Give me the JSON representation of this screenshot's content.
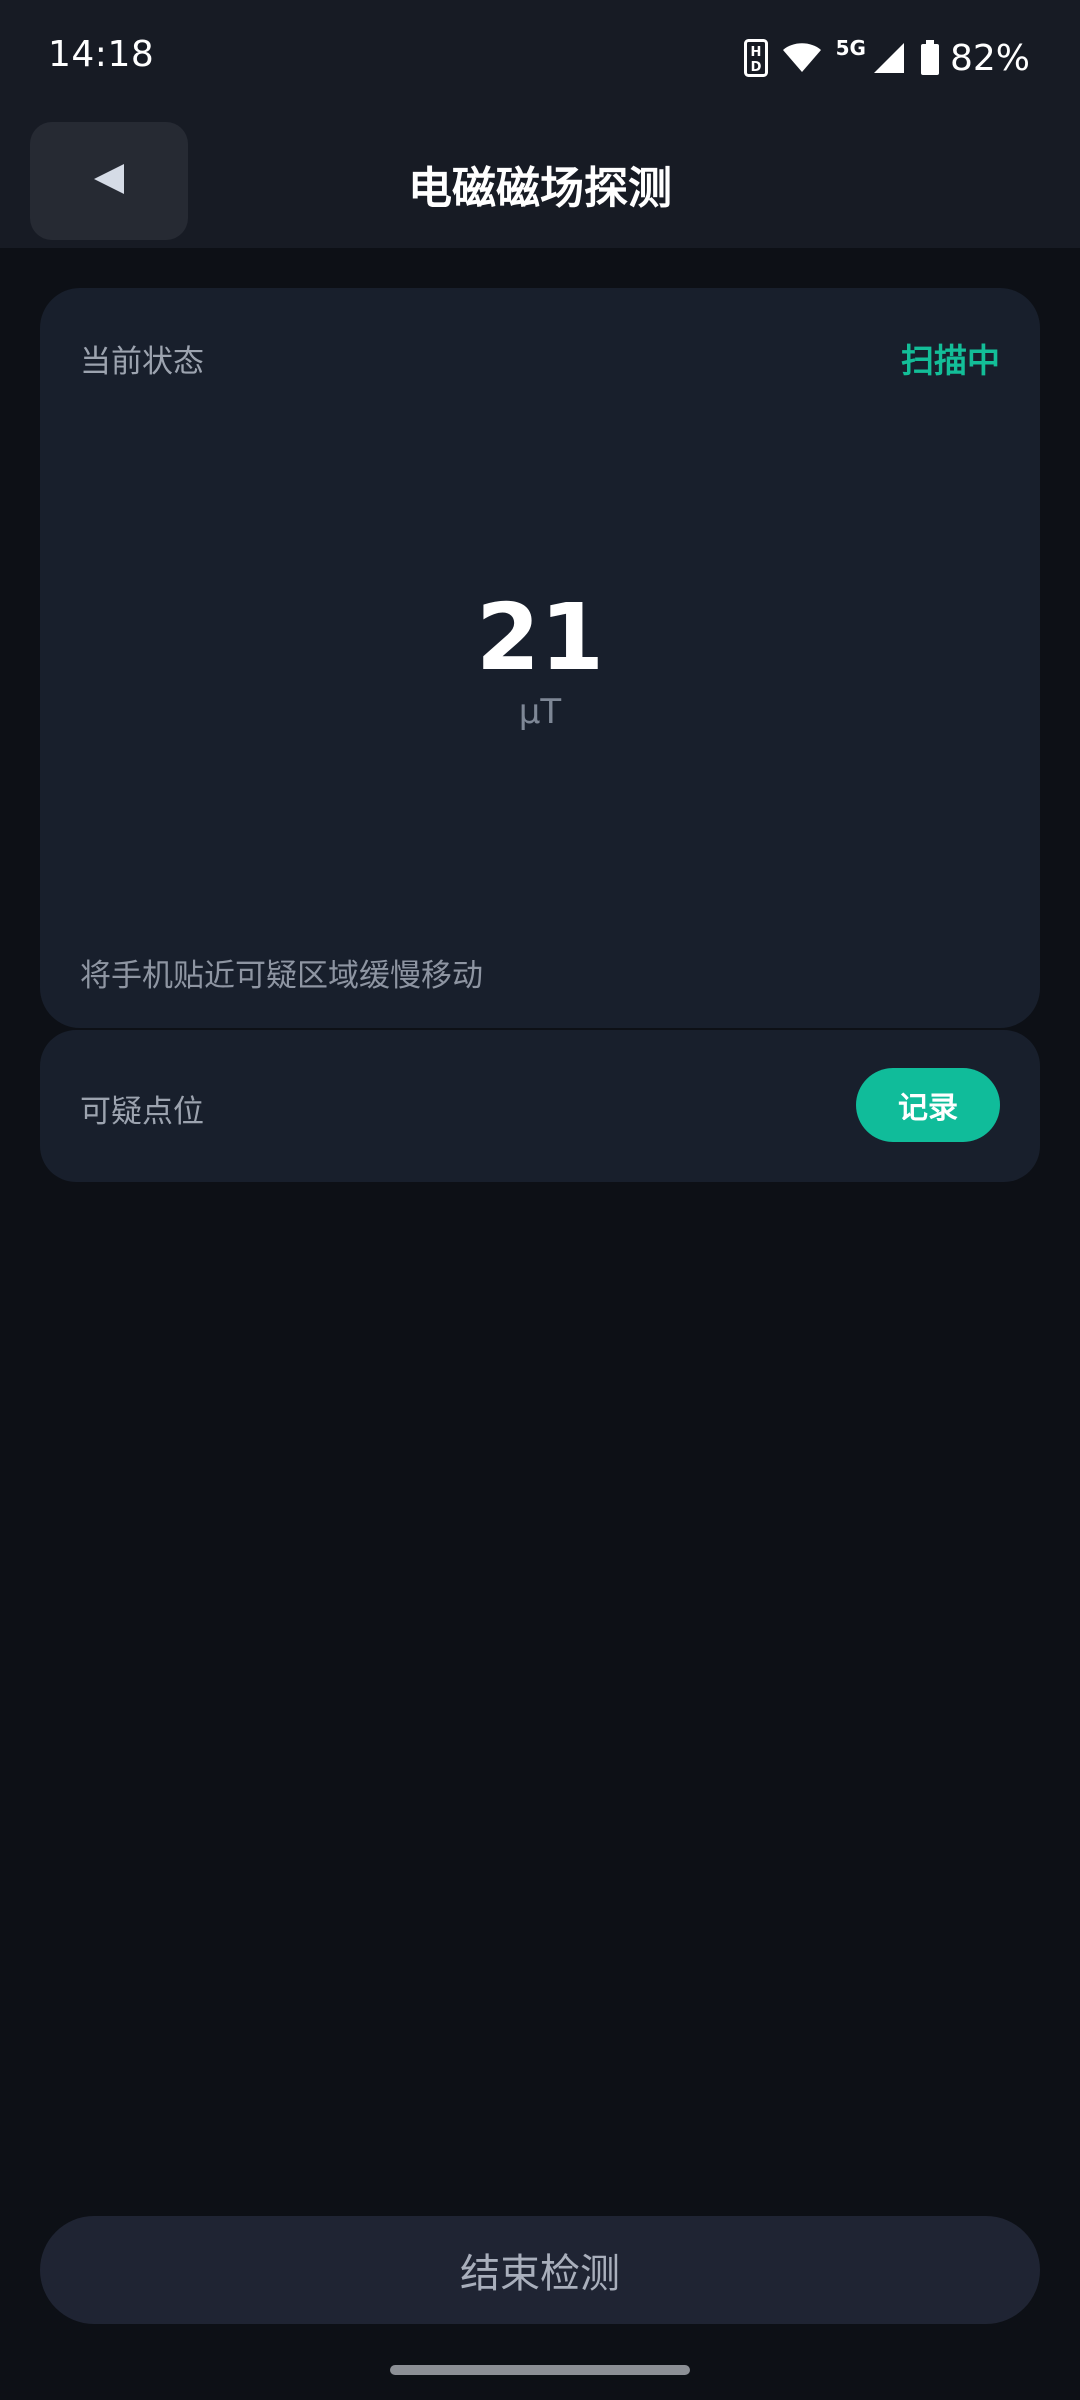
{
  "status_bar": {
    "time": "14:18",
    "network": "5G",
    "battery": "82%",
    "icons": [
      "hd-icon",
      "wifi-icon",
      "signal-icon",
      "battery-icon"
    ]
  },
  "header": {
    "back_icon": "back-triangle-icon",
    "title": "电磁磁场探测"
  },
  "reading_card": {
    "label": "当前状态",
    "status": "扫描中",
    "value": "21",
    "unit": "μT",
    "hint": "将手机贴近可疑区域缓慢移动"
  },
  "points_card": {
    "label": "可疑点位",
    "record_button": "记录"
  },
  "footer": {
    "end_button": "结束检测"
  },
  "colors": {
    "background": "#0D1016",
    "card": "#181F2C",
    "accent": "#13BE98",
    "header": "#171B24"
  }
}
